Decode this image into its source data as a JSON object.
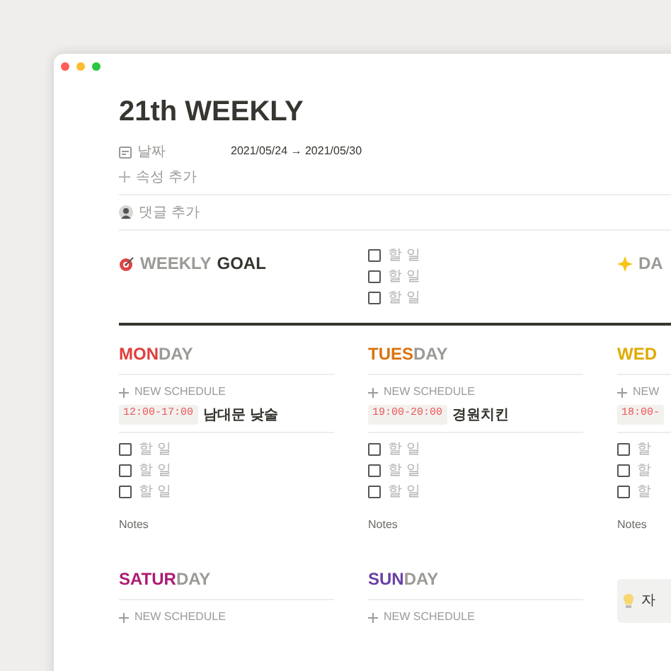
{
  "window": {
    "title": "21th WEEKLY"
  },
  "properties": [
    {
      "kind": "date",
      "label": "날짜",
      "value": "2021/05/24 → 2021/05/30"
    },
    {
      "kind": "add",
      "label": "속성 추가"
    }
  ],
  "comment": {
    "label": "댓글 추가"
  },
  "goal": {
    "prefix": "WEEKLY",
    "title": "GOAL"
  },
  "goal_todos": [
    {
      "label": "할 일",
      "checked": false
    },
    {
      "label": "할 일",
      "checked": false
    },
    {
      "label": "할 일",
      "checked": false
    }
  ],
  "daily": {
    "title": "DA"
  },
  "days": [
    {
      "highlight": "MON",
      "rest": "DAY",
      "color": "#e03e3e",
      "add_label": "NEW SCHEDULE",
      "schedules": [
        {
          "time": "12:00-17:00",
          "title": "남대문 낮술"
        }
      ],
      "todos": [
        {
          "label": "할 일",
          "checked": false
        },
        {
          "label": "할 일",
          "checked": false
        },
        {
          "label": "할 일",
          "checked": false
        }
      ],
      "notes": "Notes"
    },
    {
      "highlight": "TUES",
      "rest": "DAY",
      "color": "#d9730d",
      "add_label": "NEW SCHEDULE",
      "schedules": [
        {
          "time": "19:00-20:00",
          "title": "경원치킨"
        }
      ],
      "todos": [
        {
          "label": "할 일",
          "checked": false
        },
        {
          "label": "할 일",
          "checked": false
        },
        {
          "label": "할 일",
          "checked": false
        }
      ],
      "notes": "Notes"
    },
    {
      "highlight": "WED",
      "color": "#dfab01",
      "add_label": "NEW",
      "schedules": [
        {
          "time": "18:00-"
        }
      ],
      "todos": [
        {
          "label": "할",
          "checked": false
        },
        {
          "label": "할",
          "checked": false
        },
        {
          "label": "할",
          "checked": false
        }
      ],
      "notes": "Notes"
    },
    {
      "highlight": "SATUR",
      "rest": "DAY",
      "color": "#ad1a72",
      "add_label": "NEW SCHEDULE"
    },
    {
      "highlight": "SUN",
      "rest": "DAY",
      "color": "#6940a5",
      "add_label": "NEW SCHEDULE"
    }
  ],
  "callout": {
    "text": "자"
  }
}
